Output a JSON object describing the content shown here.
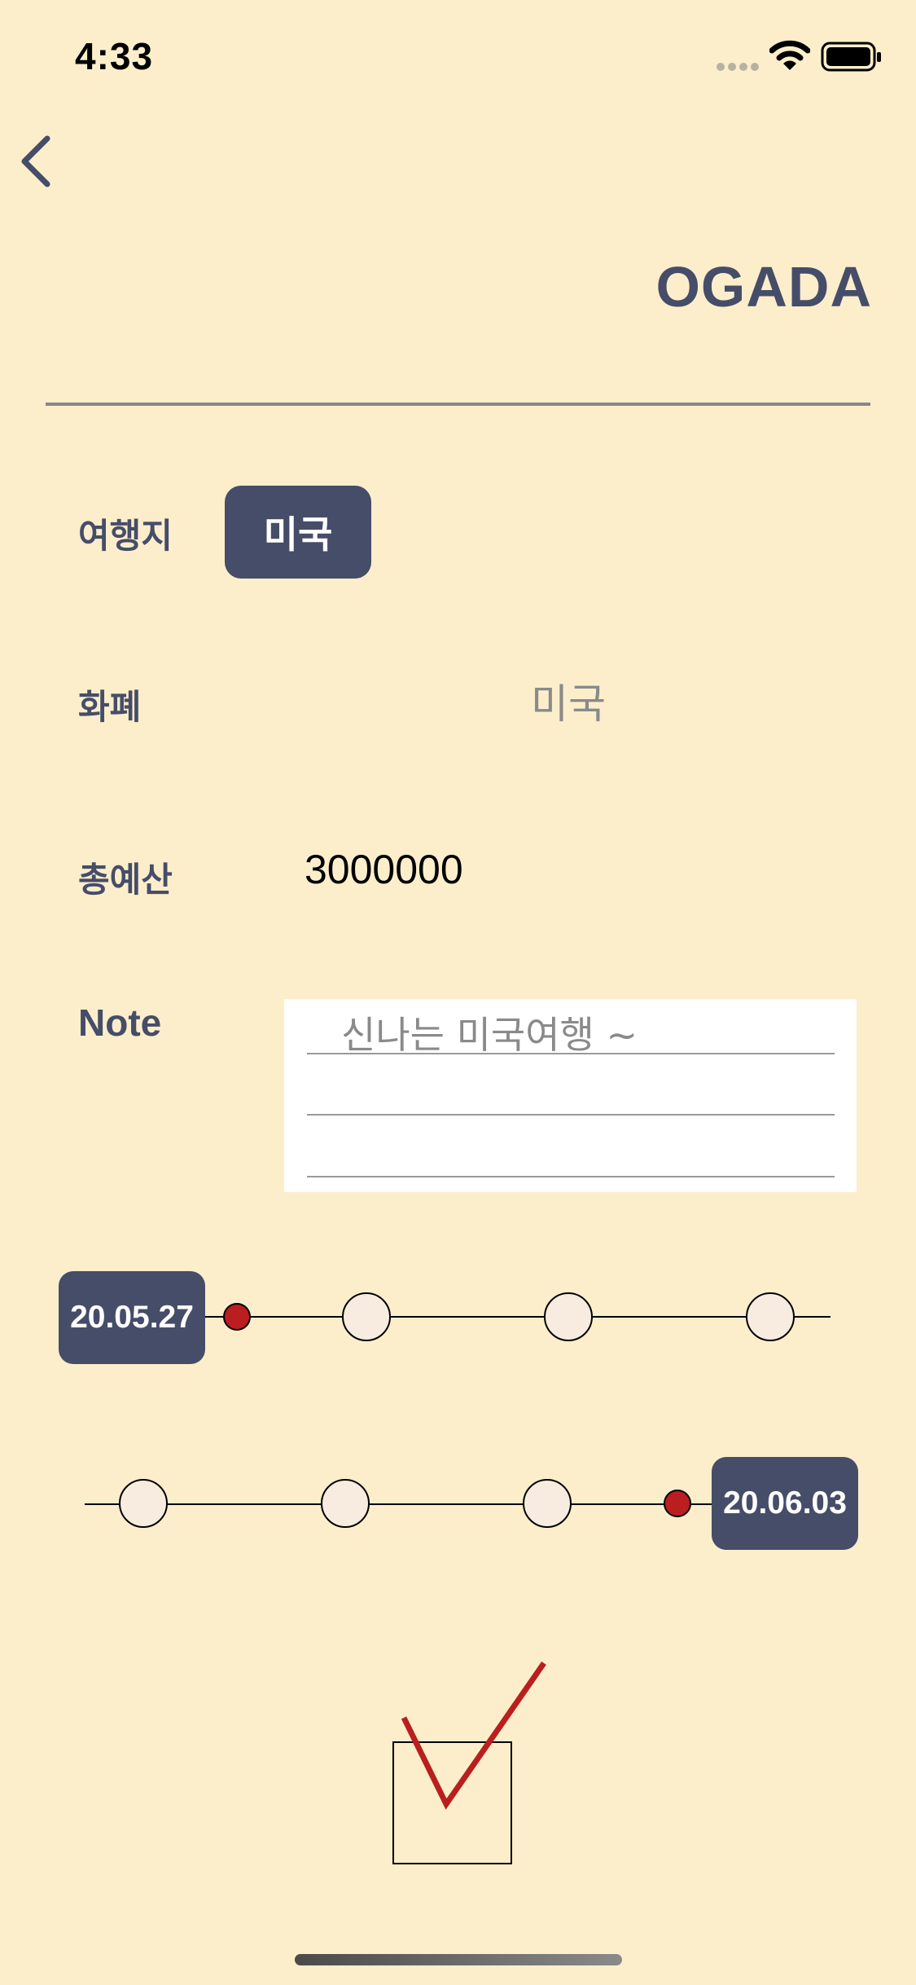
{
  "status_bar": {
    "time": "4:33",
    "icons": [
      "cellular-signal-icon",
      "wifi-icon",
      "battery-icon"
    ]
  },
  "nav": {
    "back_icon": "chevron-left-icon"
  },
  "header": {
    "title": "OGADA"
  },
  "form": {
    "destination": {
      "label": "여행지",
      "value": "미국"
    },
    "currency": {
      "label": "화폐",
      "value": "미국"
    },
    "budget": {
      "label": "총예산",
      "value": "3000000"
    },
    "note": {
      "label": "Note",
      "value": "신나는 미국여행 ~"
    }
  },
  "timeline": {
    "start_date": "20.05.27",
    "end_date": "20.06.03"
  },
  "confirm": {
    "icon": "checkmark-icon"
  },
  "colors": {
    "background": "#FCEECB",
    "accent": "#464D69",
    "marker": "#BB1E1E",
    "node_fill": "#F8ECE0"
  }
}
